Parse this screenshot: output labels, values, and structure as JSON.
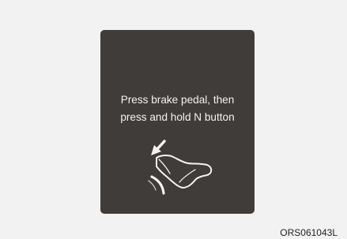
{
  "display": {
    "message_line_1": "Press brake pedal, then",
    "message_line_2": "press and hold N button",
    "graphic_icon": "brake-pedal-foot-press-icon",
    "background_color": "#3f3c39",
    "text_color": "#f3f3f3"
  },
  "figure": {
    "code": "ORS061043L"
  }
}
